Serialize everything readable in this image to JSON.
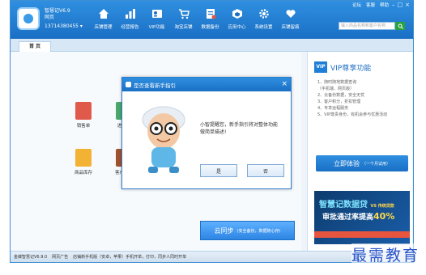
{
  "header": {
    "brand": "智慧记V6.9",
    "brand_sub": "网页",
    "account": "13714380455",
    "top_links": [
      "论坛",
      "客服",
      "帮助"
    ],
    "search_placeholder": "输入商品名称和客户名称",
    "nav": [
      {
        "label": "店铺管理",
        "icon": "home-icon"
      },
      {
        "label": "经营报告",
        "icon": "bar-chart-icon"
      },
      {
        "label": "VIP功能",
        "icon": "vip-card-icon"
      },
      {
        "label": "淘宝店铺",
        "icon": "cart-icon"
      },
      {
        "label": "数据备份",
        "icon": "backup-icon"
      },
      {
        "label": "应用中心",
        "icon": "app-center-icon"
      },
      {
        "label": "系统设置",
        "icon": "gear-icon"
      },
      {
        "label": "店铺留痕",
        "icon": "heart-icon"
      }
    ]
  },
  "tabs": [
    {
      "label": "首 页"
    }
  ],
  "main": {
    "tiles": [
      {
        "label": "销售单",
        "color": "#e05a4b"
      },
      {
        "label": "进货单",
        "color": "#4aa86a"
      },
      {
        "label": "商品库存",
        "color": "#f2b233"
      },
      {
        "label": "客户欠款",
        "color": "#a0522d"
      }
    ],
    "cloud_sync": {
      "label": "云同步",
      "sub": "(安全备份，数据随心存)"
    }
  },
  "dialog": {
    "title": "是否查看新手指引",
    "message": "小智提醒您，新手指引将对整体功能做简单描述!",
    "yes": "是",
    "no": "否"
  },
  "vip": {
    "badge": "VIP",
    "title": "VIP尊享功能",
    "features": [
      "1、随时随地数据查询",
      "   （手机端、网页版）",
      "2、云备份数据，安全无忧",
      "3、客户积分，折扣管理",
      "4、专享远程服务",
      "5、VIP尊贵身份，有机会参与优惠活动"
    ],
    "try_label": "立即体验",
    "try_sub": "（一个月试用）",
    "ad_title": "智慧记数据贷",
    "ad_tag": "VS 传统贷款",
    "ad_line": "审批通过率提高",
    "ad_percent": "40%"
  },
  "status": {
    "version": "金蝶智慧记V6.9.0",
    "links": "网页广告",
    "text": "店铺新手机版（安卓，苹果）手机开单，打印，同步人同时开单"
  },
  "watermark": "最需教育",
  "colors": {
    "accent": "#1f7fd6",
    "ad_accent": "#e8553e"
  }
}
